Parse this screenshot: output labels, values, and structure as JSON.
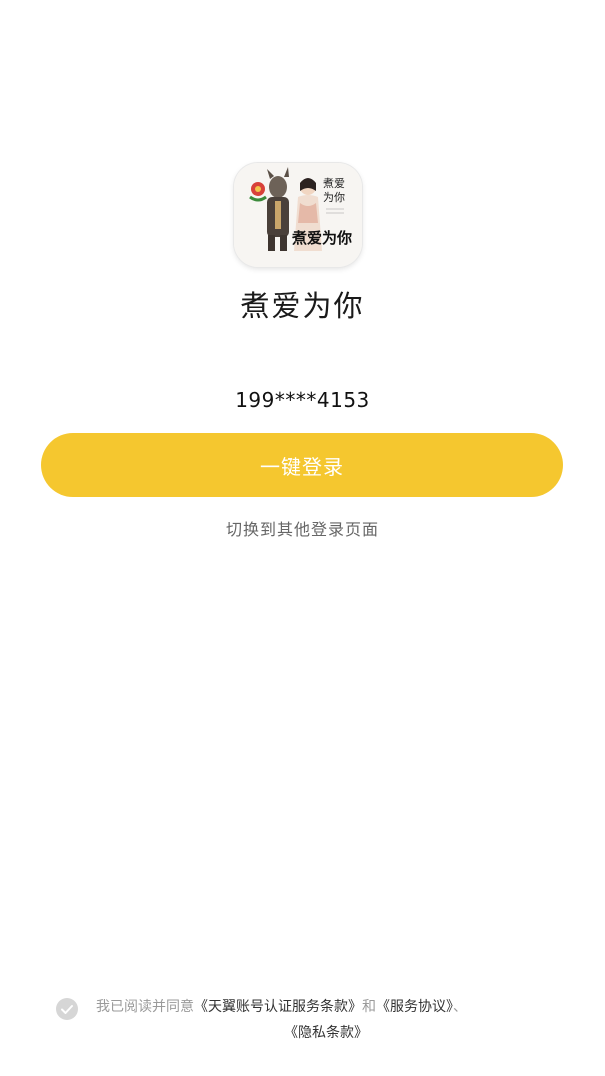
{
  "app": {
    "name": "煮爱为你",
    "icon_name": "app-logo-icon",
    "icon_lettering": "煮爱为你"
  },
  "login": {
    "masked_phone": "199****4153",
    "one_click_label": "一键登录",
    "switch_label": "切换到其他登录页面"
  },
  "agreement": {
    "prefix": "我已阅读并同意",
    "tianyi_terms": "《天翼账号认证服务条款》",
    "and": "和",
    "service_agreement": "《服务协议》",
    "separator": "、",
    "privacy_terms": "《隐私条款》",
    "checked": false
  },
  "colors": {
    "accent": "#f5c72f",
    "text_primary": "#1a1a1a",
    "text_secondary": "#666666",
    "text_muted": "#9a9a9a"
  }
}
